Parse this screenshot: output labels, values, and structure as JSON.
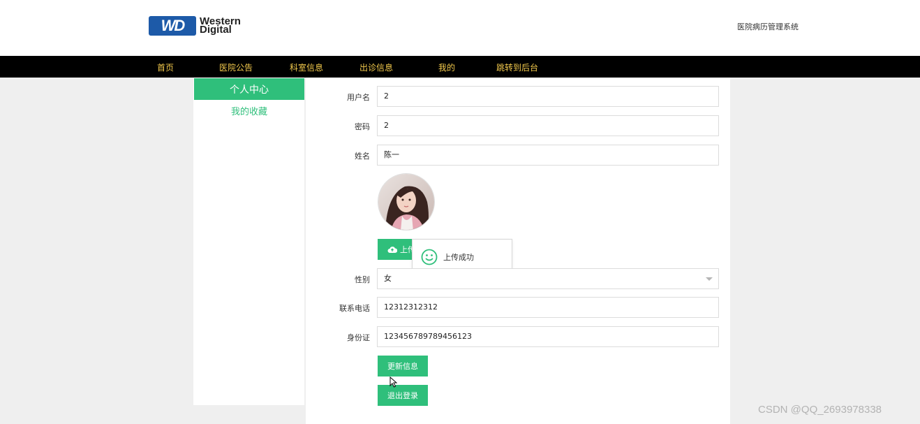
{
  "header": {
    "logo_mark": "WD",
    "logo_line1": "Western",
    "logo_line2": "Digital",
    "site_title": "医院病历管理系统"
  },
  "nav": {
    "items": [
      "首页",
      "医院公告",
      "科室信息",
      "出诊信息",
      "我的",
      "跳转到后台"
    ]
  },
  "sidebar": {
    "active": "个人中心",
    "link": "我的收藏"
  },
  "form": {
    "username_label": "用户名",
    "username_value": "2",
    "password_label": "密码",
    "password_value": "2",
    "name_label": "姓名",
    "name_value": "陈一",
    "upload_button": "上传",
    "gender_label": "性别",
    "gender_value": "女",
    "phone_label": "联系电话",
    "phone_value": "12312312312",
    "idcard_label": "身份证",
    "idcard_value": "123456789789456123",
    "update_button": "更新信息",
    "logout_button": "退出登录"
  },
  "toast": {
    "icon": "smile-icon",
    "message": "上传成功"
  },
  "watermark": "CSDN @QQ_2693978338",
  "colors": {
    "accent": "#2fbf7b",
    "nav_bg": "#000000",
    "nav_text": "#f2c94c",
    "logo_blue": "#1d5aa8"
  }
}
